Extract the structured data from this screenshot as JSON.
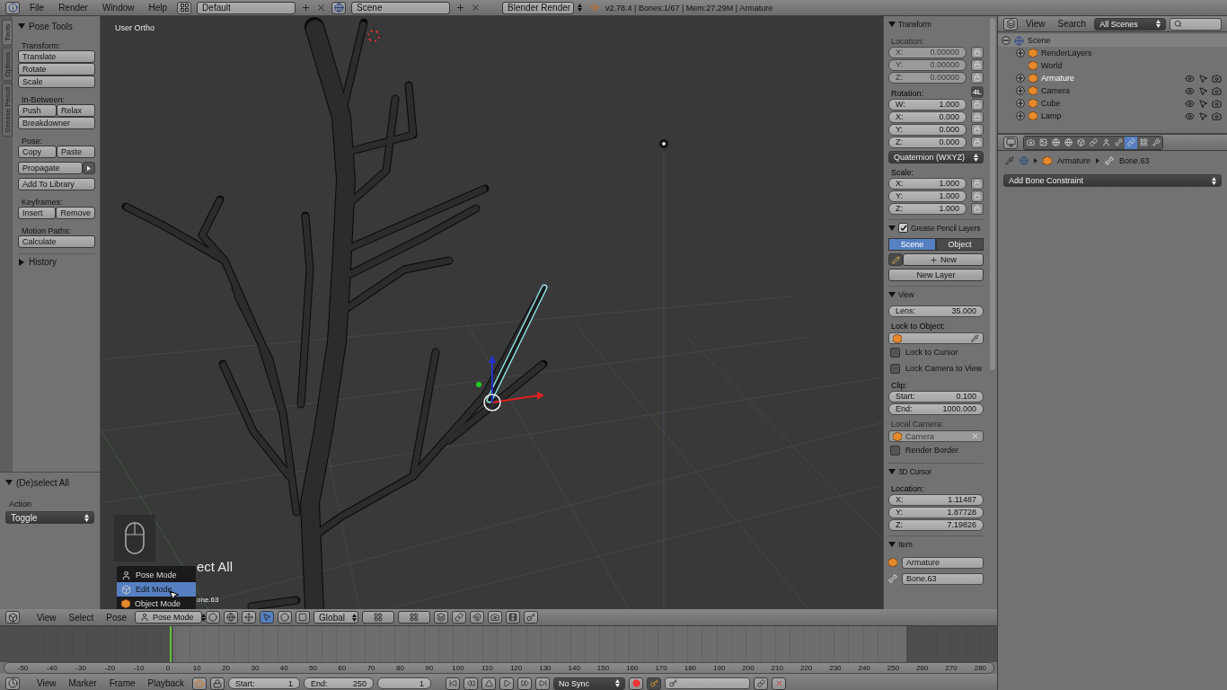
{
  "top_bar": {
    "menus": [
      "File",
      "Render",
      "Window",
      "Help"
    ],
    "layout": "Default",
    "scene": "Scene",
    "engine": "Blender Render",
    "info": "v2.78.4 | Bones:1/67 | Mem:27.29M | Armature"
  },
  "tool_tabs": [
    {
      "label": "Tools",
      "selected": true
    },
    {
      "label": "Options",
      "selected": false
    },
    {
      "label": "Grease Pencil",
      "selected": false
    }
  ],
  "tool_panel": {
    "title": "Pose Tools",
    "expanded": true,
    "sections": [
      {
        "label": "Transform:",
        "rows": [
          {
            "kind": "buttons",
            "labels": [
              "Translate"
            ]
          },
          {
            "kind": "buttons",
            "labels": [
              "Rotate"
            ]
          },
          {
            "kind": "buttons",
            "labels": [
              "Scale"
            ]
          }
        ]
      },
      {
        "label": "In-Between:",
        "rows": [
          {
            "kind": "buttons",
            "labels": [
              "Push",
              "Relax"
            ]
          },
          {
            "kind": "buttons",
            "labels": [
              "Breakdowner"
            ]
          }
        ]
      },
      {
        "label": "Pose:",
        "rows": [
          {
            "kind": "buttons",
            "labels": [
              "Copy",
              "Paste"
            ]
          },
          {
            "kind": "split",
            "labels": [
              "Propagate"
            ]
          },
          {
            "kind": "buttons",
            "labels": [
              "Add To Library"
            ]
          }
        ]
      },
      {
        "label": "Keyframes:",
        "rows": [
          {
            "kind": "buttons",
            "labels": [
              "Insert",
              "Remove"
            ]
          }
        ]
      },
      {
        "label": "Motion Paths:",
        "rows": [
          {
            "kind": "buttons",
            "labels": [
              "Calculate"
            ]
          }
        ]
      }
    ]
  },
  "history_panel": {
    "title": "History",
    "expanded": false
  },
  "redo_panel": {
    "title": "(De)select All",
    "expanded": true,
    "field_label": "Action",
    "value": "Toggle"
  },
  "viewport": {
    "view_label": "User Ortho",
    "operator_text": "ect All",
    "bone_text": "one.63",
    "mode_menu": [
      {
        "label": "Pose Mode",
        "selected": false
      },
      {
        "label": "Edit Mode",
        "selected": true
      },
      {
        "label": "Object Mode",
        "selected": false
      }
    ]
  },
  "n_panel": {
    "transform": {
      "title": "Transform",
      "expanded": true,
      "location_label": "Location:",
      "location_disabled": true,
      "location": [
        {
          "axis": "X:",
          "value": "0.00000"
        },
        {
          "axis": "Y:",
          "value": "0.00000"
        },
        {
          "axis": "Z:",
          "value": "0.00000"
        }
      ],
      "rotation_label": "Rotation:",
      "rotation_lock": "4L",
      "rotation": [
        {
          "axis": "W:",
          "value": "1.000"
        },
        {
          "axis": "X:",
          "value": "0.000"
        },
        {
          "axis": "Y:",
          "value": "0.000"
        },
        {
          "axis": "Z:",
          "value": "0.000"
        }
      ],
      "rotation_mode": "Quaternion (WXYZ)",
      "scale_label": "Scale:",
      "scale": [
        {
          "axis": "X:",
          "value": "1.000"
        },
        {
          "axis": "Y:",
          "value": "1.000"
        },
        {
          "axis": "Z:",
          "value": "1.000"
        }
      ]
    },
    "grease_pencil": {
      "title": "Grease Pencil Layers",
      "expanded": true,
      "enabled": true,
      "tabs": [
        {
          "label": "Scene",
          "selected": true
        },
        {
          "label": "Object",
          "selected": false
        }
      ],
      "new_button": "New",
      "new_layer_button": "New Layer"
    },
    "view": {
      "title": "View",
      "expanded": true,
      "lens": {
        "axis": "Lens:",
        "value": "35.000"
      },
      "lock_label": "Lock to Object:",
      "checks": [
        {
          "label": "Lock to Cursor",
          "checked": false
        },
        {
          "label": "Lock Camera to View",
          "checked": false
        }
      ],
      "clip_label": "Clip:",
      "clip": [
        {
          "axis": "Start:",
          "value": "0.100"
        },
        {
          "axis": "End:",
          "value": "1000.000"
        }
      ],
      "local_camera_label": "Local Camera:",
      "local_camera": "Camera",
      "local_camera_disabled": true,
      "render_border": {
        "label": "Render Border",
        "checked": false
      }
    },
    "cursor": {
      "title": "3D Cursor",
      "expanded": true,
      "location_label": "Location:",
      "location": [
        {
          "axis": "X:",
          "value": "1.11487"
        },
        {
          "axis": "Y:",
          "value": "1.87728"
        },
        {
          "axis": "Z:",
          "value": "7.19826"
        }
      ]
    },
    "item": {
      "title": "Item",
      "expanded": true,
      "object": "Armature",
      "bone": "Bone.63"
    }
  },
  "outliner": {
    "menus": [
      "View",
      "Search"
    ],
    "filter": "All Scenes",
    "tree": [
      {
        "label": "Scene",
        "kind": "expandable",
        "expanded": true,
        "selected": true,
        "active": false,
        "children": [
          {
            "label": "RenderLayers",
            "kind": "expandable",
            "expanded": false,
            "selected": false,
            "active": false,
            "visible_controls": false
          },
          {
            "label": "World",
            "kind": "leaf",
            "selected": false,
            "active": false,
            "visible_controls": false
          },
          {
            "label": "Armature",
            "kind": "expandable",
            "expanded": false,
            "selected": false,
            "active": true,
            "visible_controls": true
          },
          {
            "label": "Camera",
            "kind": "expandable",
            "expanded": false,
            "selected": false,
            "active": false,
            "visible_controls": true
          },
          {
            "label": "Cube",
            "kind": "expandable",
            "expanded": false,
            "selected": false,
            "active": false,
            "visible_controls": true
          },
          {
            "label": "Lamp",
            "kind": "expandable",
            "expanded": false,
            "selected": false,
            "active": false,
            "visible_controls": true
          }
        ]
      }
    ]
  },
  "properties": {
    "tabs": [
      {
        "selected": false
      },
      {
        "selected": false
      },
      {
        "selected": false
      },
      {
        "selected": false
      },
      {
        "selected": false
      },
      {
        "selected": false
      },
      {
        "selected": false
      },
      {
        "selected": false
      },
      {
        "selected": true
      },
      {
        "selected": false
      },
      {
        "selected": false
      }
    ],
    "path": [
      "Armature",
      "Bone.63"
    ],
    "add_constraint": "Add Bone Constraint"
  },
  "view_header": {
    "menus": [
      "View",
      "Select",
      "Pose"
    ],
    "mode": "Pose Mode",
    "orientation": "Global"
  },
  "timeline": {
    "ticks": [
      "-50",
      "-40",
      "-30",
      "-20",
      "-10",
      "0",
      "10",
      "20",
      "30",
      "40",
      "50",
      "60",
      "70",
      "80",
      "90",
      "100",
      "110",
      "120",
      "130",
      "140",
      "150",
      "160",
      "170",
      "180",
      "190",
      "200",
      "210",
      "220",
      "230",
      "240",
      "250",
      "260",
      "270",
      "280"
    ],
    "menus": [
      "View",
      "Marker",
      "Frame",
      "Playback"
    ],
    "start": {
      "label": "Start:",
      "value": "1"
    },
    "end": {
      "label": "End:",
      "value": "250"
    },
    "current": "1",
    "sync": "No Sync"
  }
}
